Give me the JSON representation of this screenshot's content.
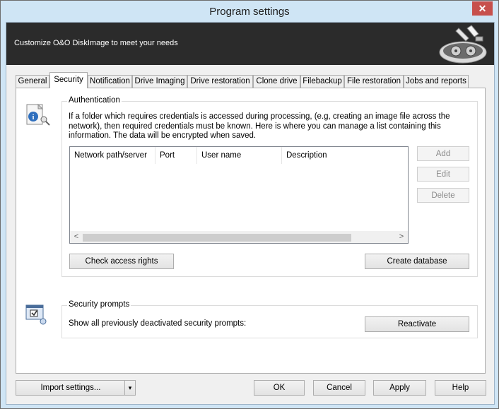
{
  "window": {
    "title": "Program settings",
    "close_glyph": "✕"
  },
  "header": {
    "text": "Customize O&O DiskImage to meet your needs",
    "logo_icon": "disk-image-logo-icon"
  },
  "tabs": [
    {
      "label": "General"
    },
    {
      "label": "Security"
    },
    {
      "label": "Notification"
    },
    {
      "label": "Drive Imaging"
    },
    {
      "label": "Drive restoration"
    },
    {
      "label": "Clone drive"
    },
    {
      "label": "Filebackup"
    },
    {
      "label": "File restoration"
    },
    {
      "label": "Jobs and reports"
    }
  ],
  "active_tab": "Security",
  "authentication": {
    "title": "Authentication",
    "description": "If a folder which requires credentials is accessed during processing, (e.g, creating an image file across the network), then required credentials must be known. Here is where you can manage a list containing this information. The data will be encrypted when saved.",
    "columns": [
      "Network path/server",
      "Port",
      "User name",
      "Description"
    ],
    "rows": [],
    "buttons": {
      "add": "Add",
      "edit": "Edit",
      "delete": "Delete",
      "check": "Check access rights",
      "create_db": "Create database"
    },
    "scroll_left": "<",
    "scroll_right": ">"
  },
  "security_prompts": {
    "title": "Security prompts",
    "label": "Show all previously deactivated security prompts:",
    "button": "Reactivate"
  },
  "footer": {
    "import": "Import settings...",
    "import_dropdown": "▾",
    "ok": "OK",
    "cancel": "Cancel",
    "apply": "Apply",
    "help": "Help"
  }
}
